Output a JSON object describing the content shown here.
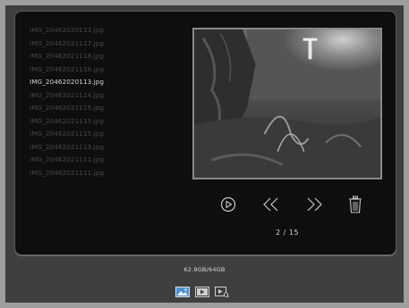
{
  "files": [
    {
      "name": "IMG_20462020113.jpg",
      "selected": false
    },
    {
      "name": "IMG_20462021117.jpg",
      "selected": false
    },
    {
      "name": "IMG_20462021118.jpg",
      "selected": false
    },
    {
      "name": "IMG_20462021118.jpg",
      "selected": false
    },
    {
      "name": "IMG_20462020113.jpg",
      "selected": true
    },
    {
      "name": "IMG_20462021114.jpg",
      "selected": false
    },
    {
      "name": "IMG_20462021115.jpg",
      "selected": false
    },
    {
      "name": "IMG_20462021115.jpg",
      "selected": false
    },
    {
      "name": "IMG_20462021115.jpg",
      "selected": false
    },
    {
      "name": "IMG_20462021113.jpg",
      "selected": false
    },
    {
      "name": "IMG_20462021111.jpg",
      "selected": false
    },
    {
      "name": "IMG_20462021111.jpg",
      "selected": false
    }
  ],
  "viewer": {
    "counter": "2 / 15",
    "controls": {
      "play_icon": "play-circle-icon",
      "prev_icon": "double-chevron-left-icon",
      "next_icon": "double-chevron-right-icon",
      "delete_icon": "trash-icon"
    }
  },
  "storage": {
    "label": "62.9GB/64GB"
  },
  "modes": [
    {
      "icon": "photo-mode-icon",
      "active": true
    },
    {
      "icon": "video-mode-icon",
      "active": false
    },
    {
      "icon": "video-playback-mode-icon",
      "active": false
    }
  ],
  "colors": {
    "accent": "#4a90d9",
    "panel_bg": "#0e0e0e",
    "text_dim": "#484848",
    "text_selected": "#d8d8d8"
  }
}
